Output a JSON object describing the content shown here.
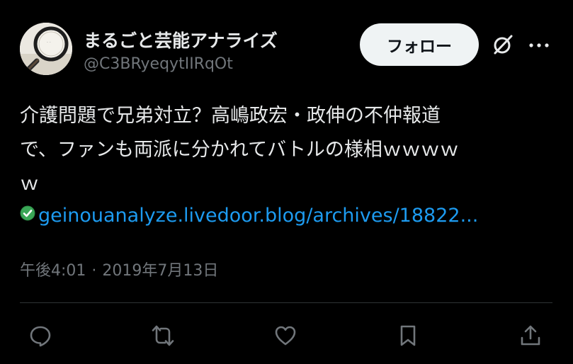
{
  "user": {
    "display_name": "まるごと芸能アナライズ",
    "handle": "@C3BRyeqytIIRqOt",
    "avatar_icon": "magnifying-glass-avatar"
  },
  "header": {
    "follow_label": "フォロー",
    "grok_icon": "grok-icon",
    "more_icon": "more-icon"
  },
  "tweet": {
    "text_lines": [
      "介護問題で兄弟対立？高嶋政宏・政伸の不仲報道",
      "で、ファンも両派に分かれてバトルの様相ｗｗｗｗ",
      "ｗ"
    ],
    "link_icon": "green-check-icon",
    "link_text": "geinouanalyze.livedoor.blog/archives/18822...",
    "time": "午後4:01",
    "separator": "·",
    "date": "2019年7月13日"
  },
  "actions": {
    "reply_icon": "reply-icon",
    "retweet_icon": "retweet-icon",
    "like_icon": "like-icon",
    "bookmark_icon": "bookmark-icon",
    "share_icon": "share-icon"
  },
  "colors": {
    "background": "#000000",
    "text": "#e7e9ea",
    "muted": "#71767b",
    "link": "#1d9bf0",
    "follow_bg": "#eff3f4",
    "divider": "#2f3336"
  }
}
